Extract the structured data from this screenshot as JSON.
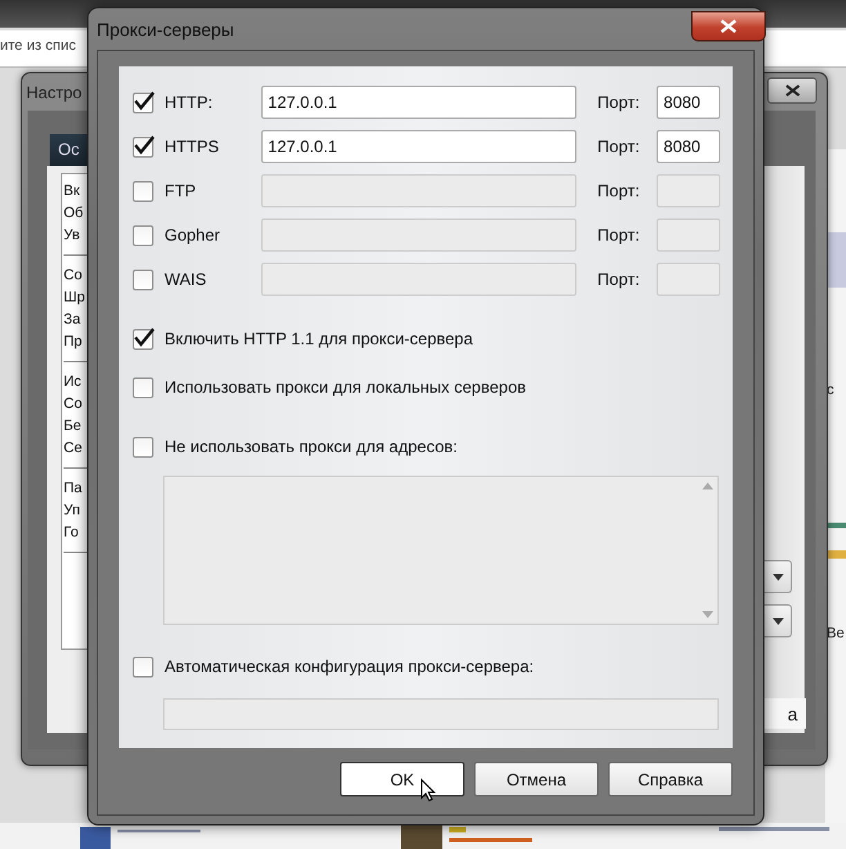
{
  "background": {
    "address_text": "ите из спис",
    "edge_texts": [
      {
        "text": "с"
      },
      {
        "text": "Ве"
      }
    ]
  },
  "settings_window": {
    "title": "Настро",
    "tab": "Ос",
    "list_groups": [
      [
        "Вк",
        "Об",
        "Ув"
      ],
      [
        "Со",
        "Шр",
        "За",
        "Пр"
      ],
      [
        "Ис",
        "Со",
        "Бе",
        "Се"
      ],
      [
        "Па",
        "Уп",
        "Го"
      ]
    ],
    "button": "а"
  },
  "dialog": {
    "title": "Прокси-серверы",
    "protocols": [
      {
        "label": "HTTP:",
        "checked": true,
        "address": "127.0.0.1",
        "port_label": "Порт:",
        "port": "8080"
      },
      {
        "label": "HTTPS",
        "checked": true,
        "address": "127.0.0.1",
        "port_label": "Порт:",
        "port": "8080"
      },
      {
        "label": "FTP",
        "checked": false,
        "port_label": "Порт:"
      },
      {
        "label": "Gopher",
        "checked": false,
        "port_label": "Порт:"
      },
      {
        "label": "WAIS",
        "checked": false,
        "port_label": "Порт:"
      }
    ],
    "options": [
      {
        "kind": "checkbox",
        "label": "Включить HTTP 1.1 для прокси-сервера",
        "checked": true
      },
      {
        "kind": "checkbox",
        "label": "Использовать прокси для локальных серверов",
        "checked": false
      },
      {
        "kind": "textarea",
        "label": "Не использовать прокси для адресов:",
        "checked": false
      },
      {
        "kind": "field",
        "label": "Автоматическая конфигурация прокси-сервера:",
        "checked": false
      }
    ],
    "buttons": [
      {
        "label": "OK",
        "selected": true
      },
      {
        "label": "Отмена",
        "selected": false
      },
      {
        "label": "Справка",
        "selected": false
      }
    ]
  }
}
